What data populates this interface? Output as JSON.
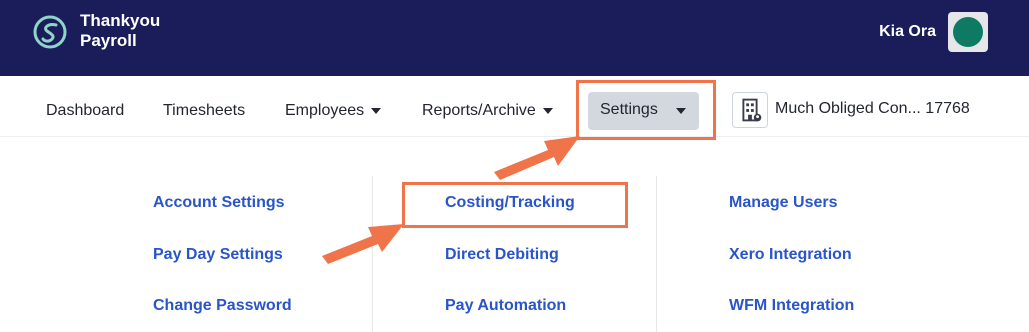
{
  "brand": {
    "line1": "Thankyou",
    "line2": "Payroll"
  },
  "header": {
    "greeting": "Kia Ora"
  },
  "nav": {
    "dashboard": "Dashboard",
    "timesheets": "Timesheets",
    "employees": "Employees",
    "reports": "Reports/Archive",
    "settings": "Settings",
    "company": "Much Obliged Con... 17768"
  },
  "settings_menu": {
    "col1": [
      "Account Settings",
      "Pay Day Settings",
      "Change Password"
    ],
    "col2": [
      "Costing/Tracking",
      "Direct Debiting",
      "Pay Automation"
    ],
    "col3": [
      "Manage Users",
      "Xero Integration",
      "WFM Integration"
    ]
  },
  "colors": {
    "header_bg": "#1b1d5a",
    "link": "#2a55c9",
    "highlight": "#f0744a",
    "active_tab_bg": "#d3d8df",
    "avatar": "#0e7a63"
  }
}
